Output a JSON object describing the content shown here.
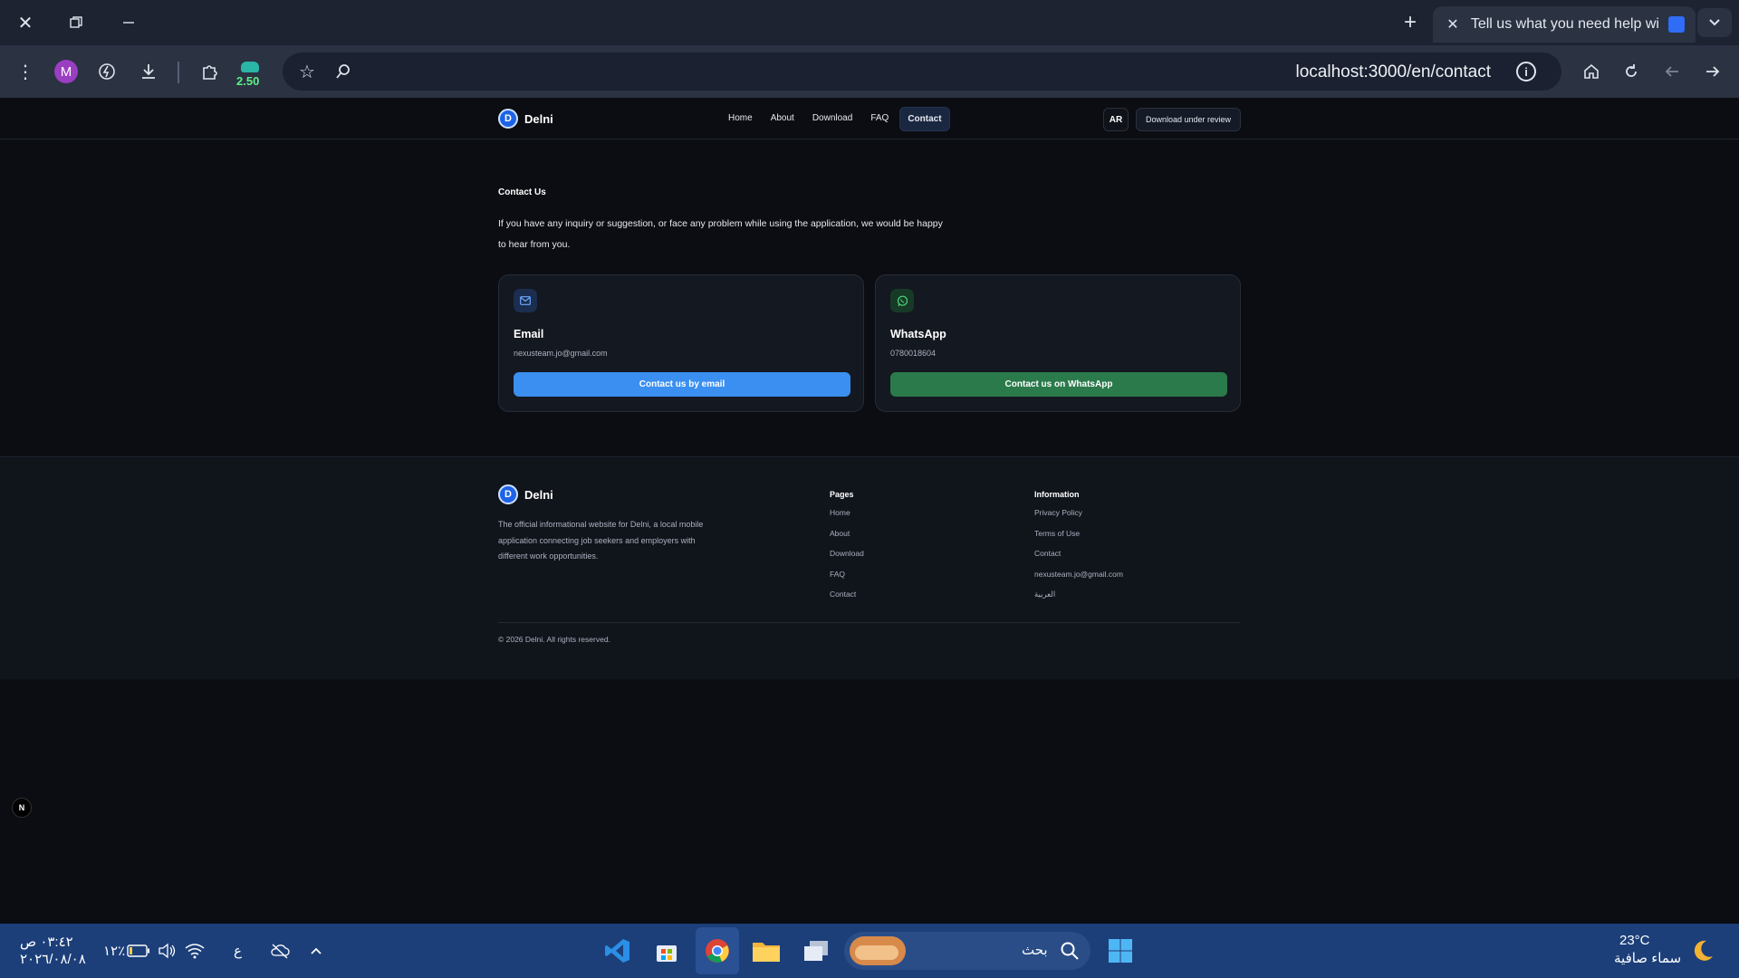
{
  "browser": {
    "tab_title": "Tell us what you need help with",
    "url": "localhost:3000/en/contact",
    "profile_initial": "M",
    "extension_badge": "2.50"
  },
  "site": {
    "brand": "Delni",
    "nav": {
      "links": [
        "Home",
        "About",
        "Download",
        "FAQ",
        "Contact"
      ],
      "active": "Contact",
      "lang_button": "AR",
      "download_button": "Download under review"
    },
    "contact": {
      "title": "Contact Us",
      "description": "If you have any inquiry or suggestion, or face any problem while using the application, we would be happy to hear from you.",
      "email_card": {
        "title": "Email",
        "value": "nexusteam.jo@gmail.com",
        "button": "Contact us by email",
        "accent": "#3b8ff0"
      },
      "whatsapp_card": {
        "title": "WhatsApp",
        "value": "0780018604",
        "button": "Contact us on WhatsApp",
        "accent": "#2b7a4b"
      }
    },
    "footer": {
      "description": "The official informational website for Delni, a local mobile application connecting job seekers and employers with different work opportunities.",
      "pages_title": "Pages",
      "pages": [
        "Home",
        "About",
        "Download",
        "FAQ",
        "Contact"
      ],
      "info_title": "Information",
      "info": [
        "Privacy Policy",
        "Terms of Use",
        "Contact",
        "nexusteam.jo@gmail.com",
        "العربية"
      ],
      "copyright": "© 2026 Delni. All rights reserved."
    },
    "dev_badge": "N"
  },
  "taskbar": {
    "time": "٠٣:٤٢ ص",
    "date": "٢٠٢٦/٠٨/٠٨",
    "battery": "١٢٪",
    "input_lang": "ع",
    "search_placeholder": "بحث",
    "weather_temp": "23°C",
    "weather_desc": "سماء صافية"
  }
}
